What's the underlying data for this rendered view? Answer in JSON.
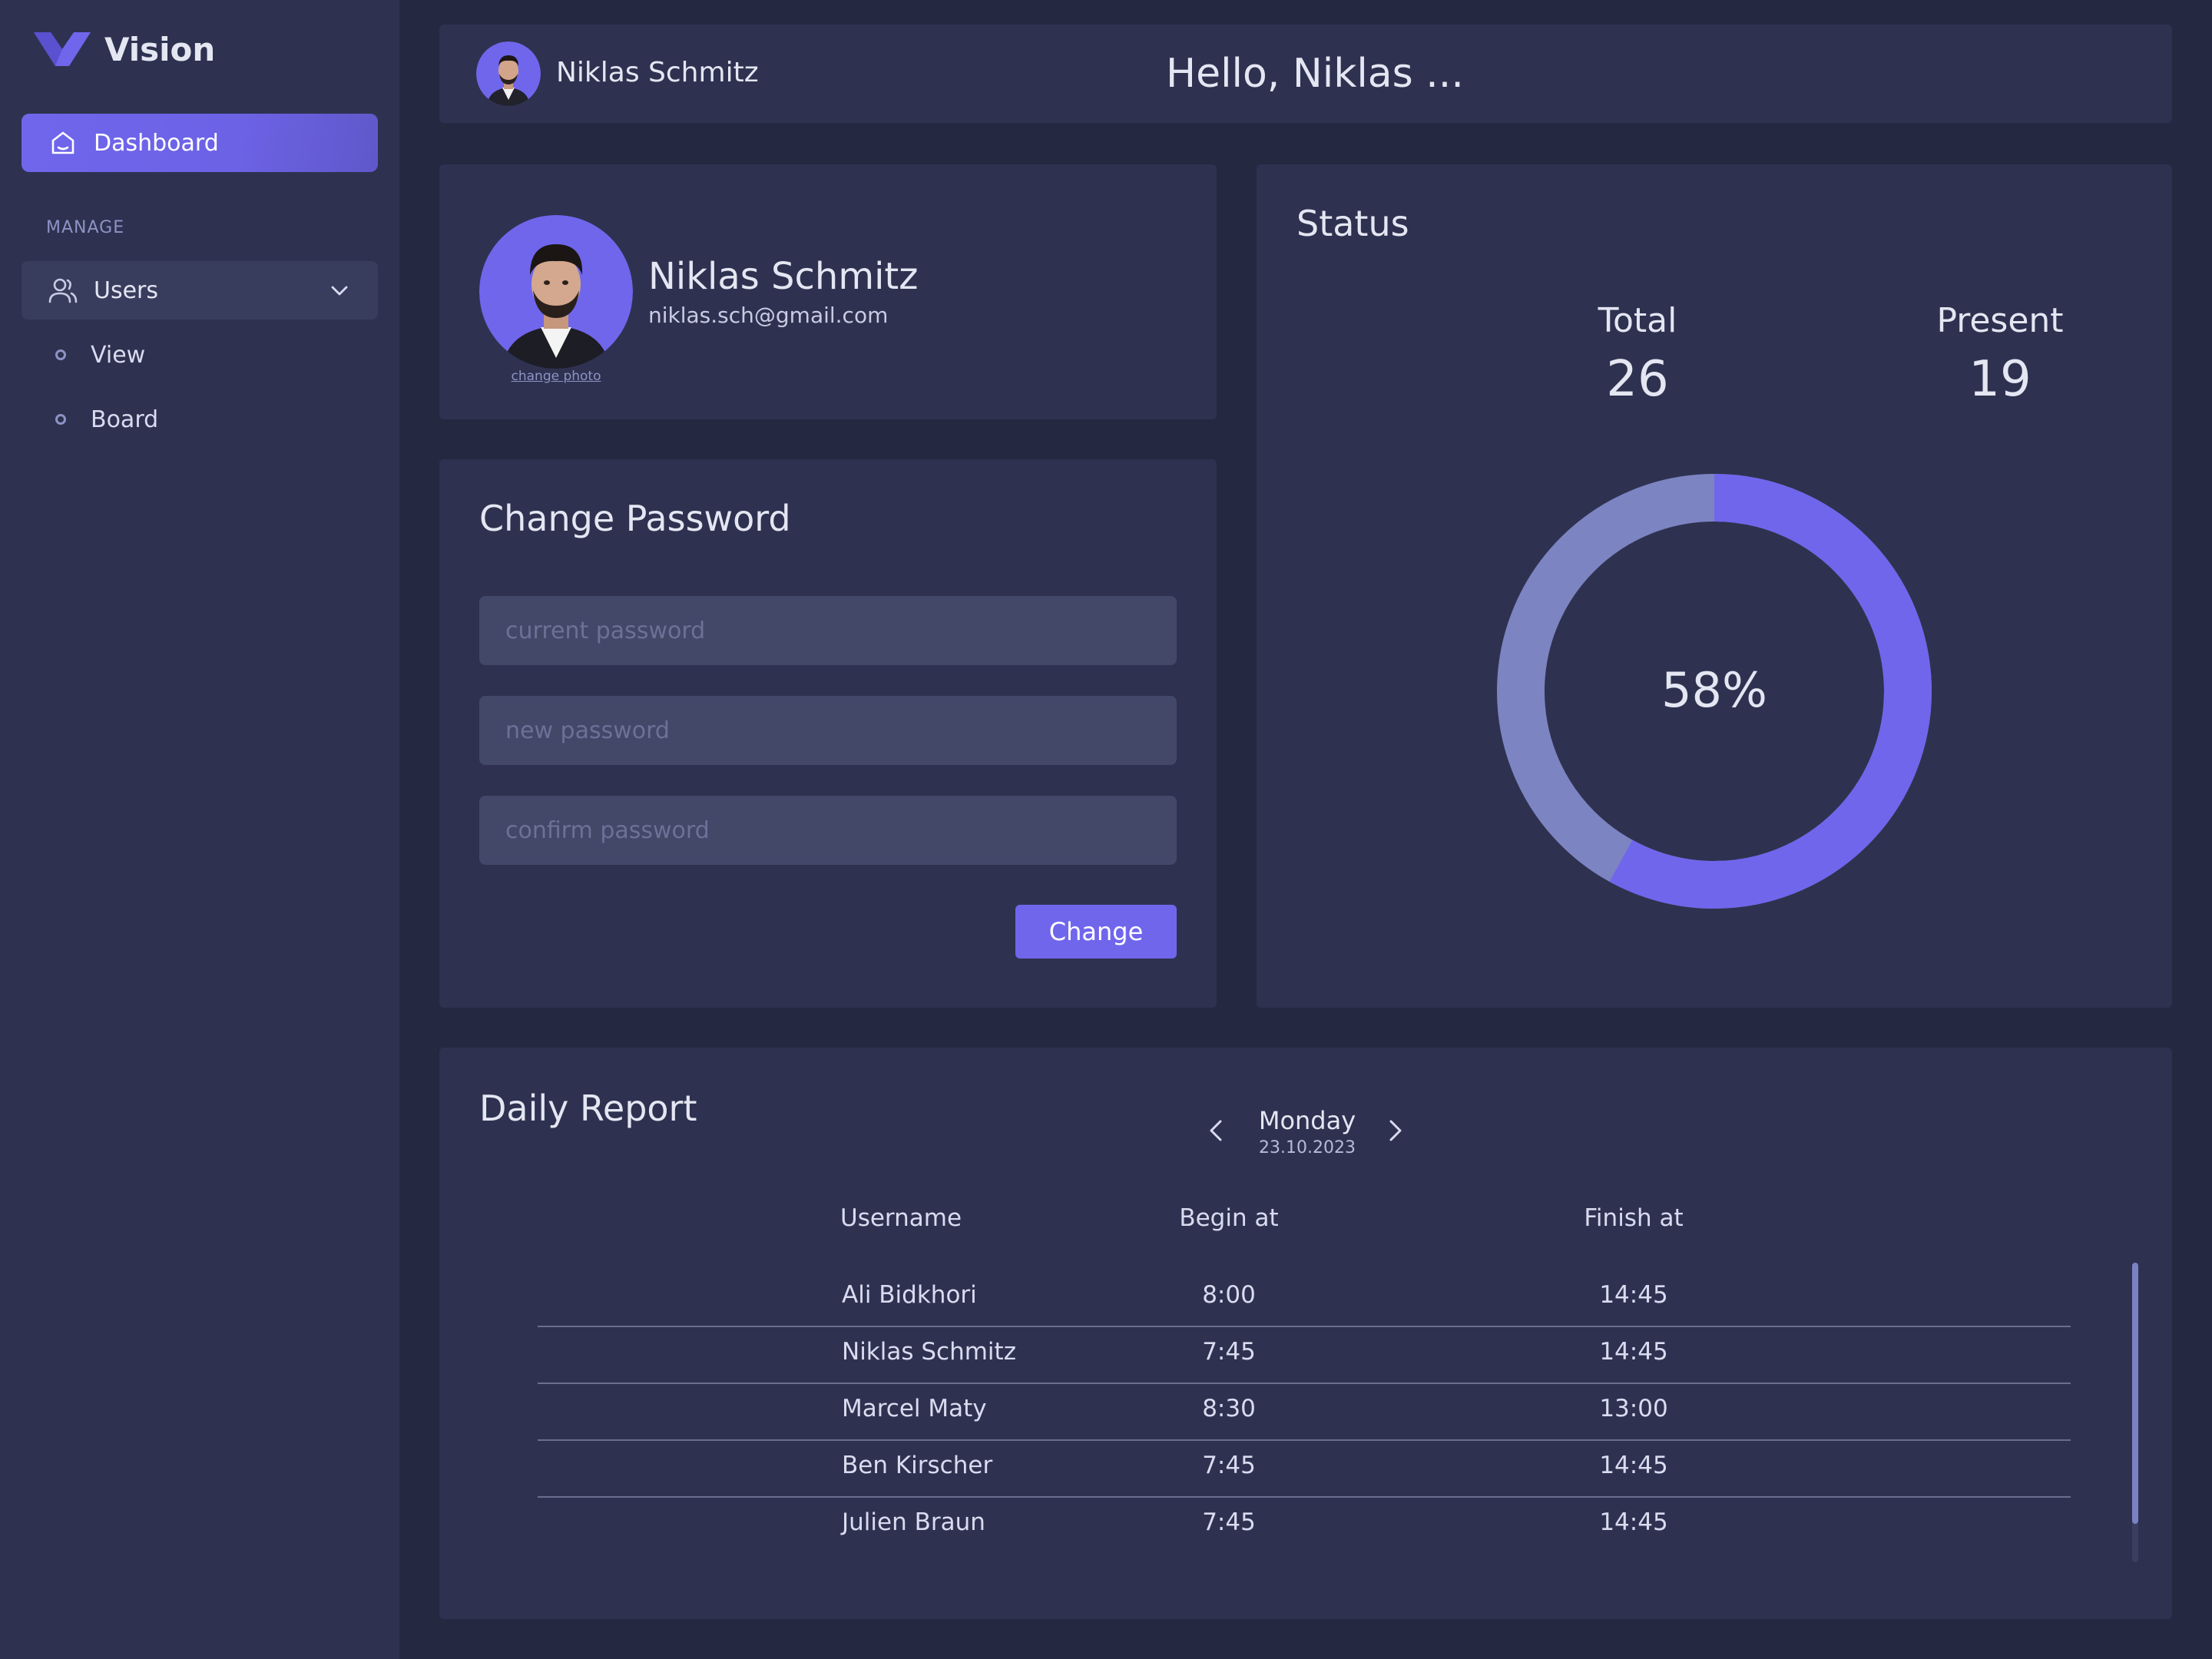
{
  "brand": {
    "name": "Vision",
    "color": "#7066ec"
  },
  "sidebar": {
    "dashboard_label": "Dashboard",
    "section_label": "MANAGE",
    "users_label": "Users",
    "sub_items": [
      {
        "label": "View"
      },
      {
        "label": "Board"
      }
    ]
  },
  "header": {
    "user_name": "Niklas Schmitz",
    "greeting": "Hello, Niklas ..."
  },
  "profile": {
    "name": "Niklas Schmitz",
    "email": "niklas.sch@gmail.com",
    "change_photo": "change photo"
  },
  "password": {
    "title": "Change Password",
    "current_placeholder": "current password",
    "new_placeholder": "new password",
    "confirm_placeholder": "confirm password",
    "button": "Change"
  },
  "status": {
    "title": "Status",
    "total_label": "Total",
    "total_value": "26",
    "present_label": "Present",
    "present_value": "19",
    "percent_label": "58%",
    "percent": 58,
    "colors": {
      "progress": "#7066ec",
      "remaining": "#7c84c2"
    }
  },
  "report": {
    "title": "Daily Report",
    "day": "Monday",
    "date": "23.10.2023",
    "headers": {
      "username": "Username",
      "begin": "Begin at",
      "finish": "Finish at"
    },
    "rows": [
      {
        "username": "Ali Bidkhori",
        "begin": "8:00",
        "finish": "14:45"
      },
      {
        "username": "Niklas Schmitz",
        "begin": "7:45",
        "finish": "14:45"
      },
      {
        "username": "Marcel Maty",
        "begin": "8:30",
        "finish": "13:00"
      },
      {
        "username": "Ben Kirscher",
        "begin": "7:45",
        "finish": "14:45"
      },
      {
        "username": "Julien Braun",
        "begin": "7:45",
        "finish": "14:45"
      }
    ]
  }
}
